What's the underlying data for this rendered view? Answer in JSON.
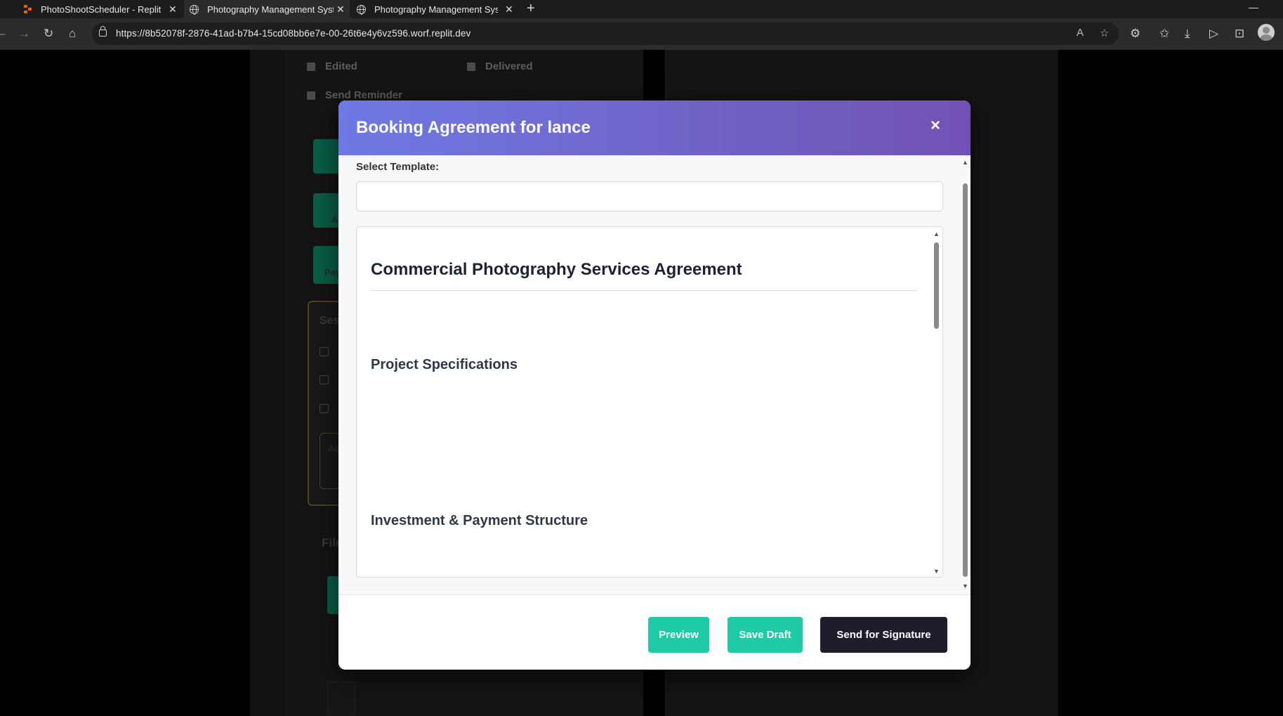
{
  "browser": {
    "tabs": [
      {
        "title": "PhotoShootScheduler - Replit",
        "icon": "replit-logo"
      },
      {
        "title": "Photography Management System",
        "icon": "globe-icon"
      },
      {
        "title": "Photography Management System",
        "icon": "globe-icon"
      }
    ],
    "url": "https://8b52078f-2876-41ad-b7b4-15cd08bb6e7e-00-26t6e4y6vz596.worf.replit.dev"
  },
  "background_page": {
    "checkboxes": {
      "edited": "Edited",
      "delivered": "Delivered",
      "send_reminder": "Send Reminder"
    },
    "partial_button_1": "A",
    "partial_button_2": "Pay",
    "session_label": "Ses",
    "notes_placeholder": "Ac",
    "files_label": "File"
  },
  "modal": {
    "title": "Booking Agreement for lance",
    "close_symbol": "×",
    "template_label": "Select Template:",
    "template_value": "",
    "document": {
      "heading": "Commercial Photography Services Agreement",
      "sections": [
        "Project Specifications",
        "Investment & Payment Structure"
      ]
    },
    "buttons": {
      "preview": "Preview",
      "save_draft": "Save Draft",
      "send": "Send for Signature"
    },
    "colors": {
      "header_gradient_start": "#6f79e3",
      "header_gradient_end": "#7152b3",
      "teal": "#1fcba7",
      "dark": "#1f1d29"
    }
  }
}
